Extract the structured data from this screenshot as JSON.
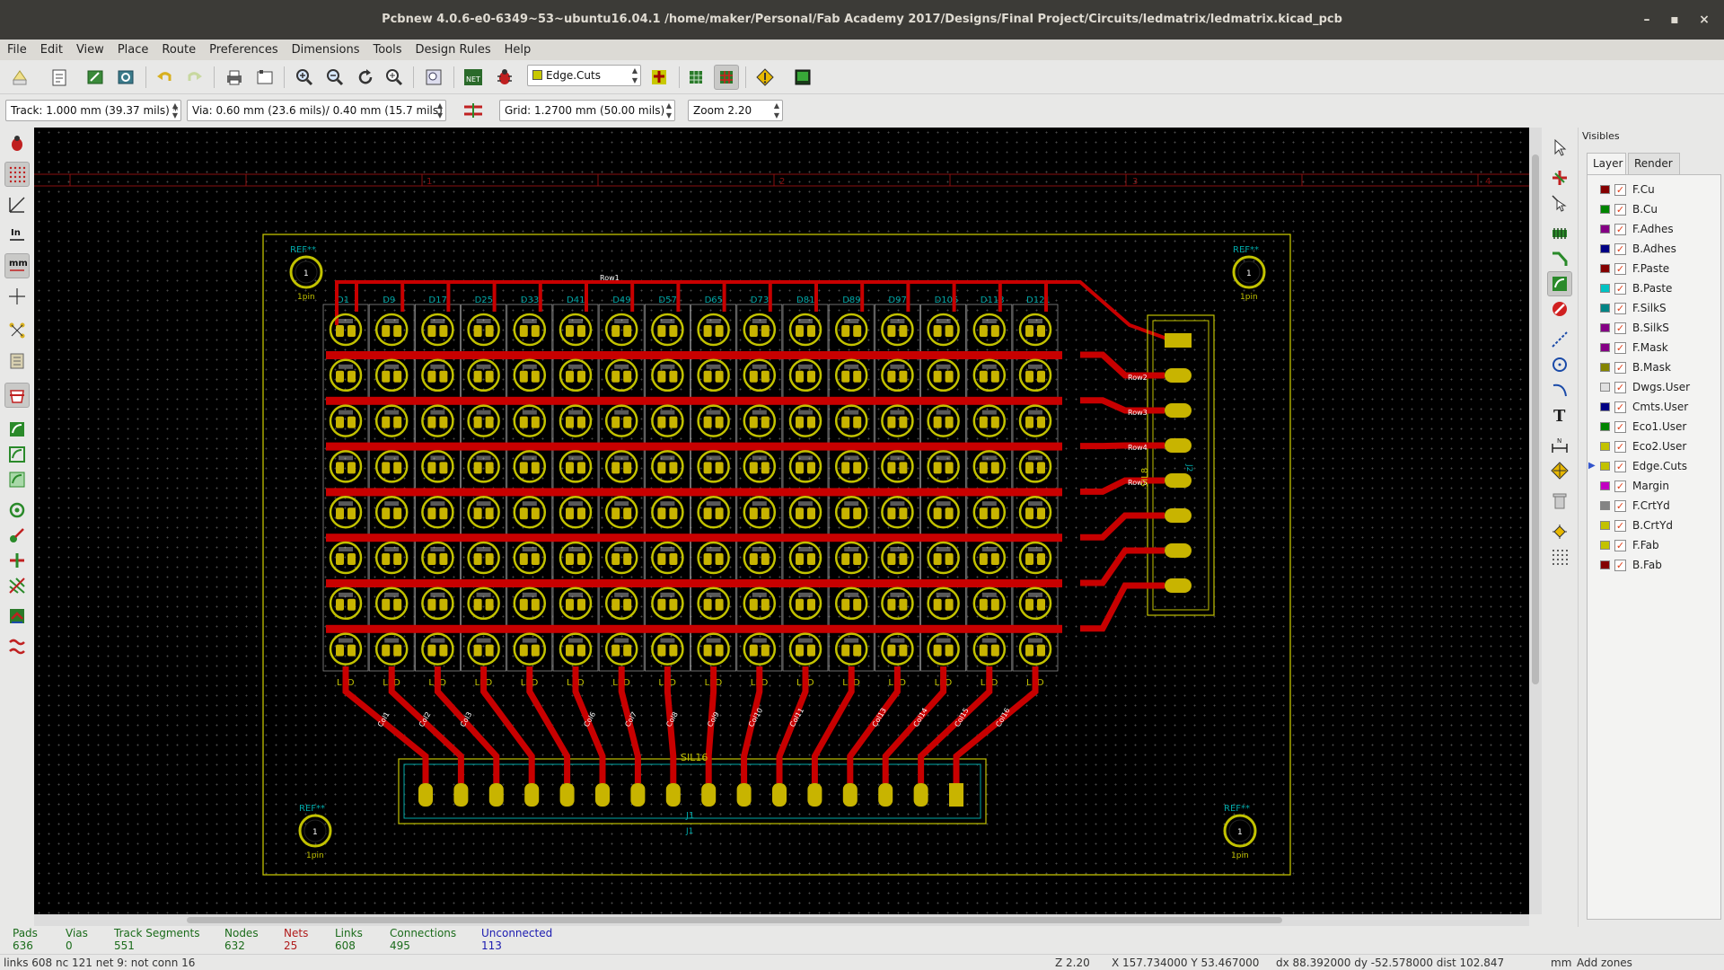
{
  "window": {
    "title": "Pcbnew 4.0.6-e0-6349~53~ubuntu16.04.1 /home/maker/Personal/Fab Academy 2017/Designs/Final Project/Circuits/ledmatrix/ledmatrix.kicad_pcb",
    "min_glyph": "–",
    "max_glyph": "▪",
    "close_glyph": "×"
  },
  "menu": [
    "File",
    "Edit",
    "View",
    "Place",
    "Route",
    "Preferences",
    "Dimensions",
    "Tools",
    "Design Rules",
    "Help"
  ],
  "toolbar": {
    "active_layer": "Edge.Cuts",
    "active_layer_color": "#c8c800"
  },
  "options": {
    "track": "Track: 1.000 mm (39.37 mils) *",
    "via": "Via: 0.60 mm (23.6 mils)/ 0.40 mm (15.7 mils) *",
    "grid": "Grid: 1.2700 mm (50.00 mils)",
    "zoom": "Zoom 2.20"
  },
  "visibles": {
    "title": "Visibles",
    "tabs": [
      "Layer",
      "Render"
    ],
    "active_tab": "Layer",
    "selected_layer": "Edge.Cuts",
    "layers": [
      {
        "name": "F.Cu",
        "color": "#840000",
        "checked": true
      },
      {
        "name": "B.Cu",
        "color": "#008400",
        "checked": true
      },
      {
        "name": "F.Adhes",
        "color": "#840084",
        "checked": true
      },
      {
        "name": "B.Adhes",
        "color": "#000084",
        "checked": true
      },
      {
        "name": "F.Paste",
        "color": "#840000",
        "checked": true
      },
      {
        "name": "B.Paste",
        "color": "#00c2c2",
        "checked": true
      },
      {
        "name": "F.SilkS",
        "color": "#008484",
        "checked": true
      },
      {
        "name": "B.SilkS",
        "color": "#840084",
        "checked": true
      },
      {
        "name": "F.Mask",
        "color": "#840084",
        "checked": true
      },
      {
        "name": "B.Mask",
        "color": "#848400",
        "checked": true
      },
      {
        "name": "Dwgs.User",
        "color": "#e0e0e0",
        "checked": true
      },
      {
        "name": "Cmts.User",
        "color": "#000084",
        "checked": true
      },
      {
        "name": "Eco1.User",
        "color": "#008400",
        "checked": true
      },
      {
        "name": "Eco2.User",
        "color": "#c2c200",
        "checked": true
      },
      {
        "name": "Edge.Cuts",
        "color": "#c2c200",
        "checked": true
      },
      {
        "name": "Margin",
        "color": "#c200c2",
        "checked": true
      },
      {
        "name": "F.CrtYd",
        "color": "#848484",
        "checked": true
      },
      {
        "name": "B.CrtYd",
        "color": "#c2c200",
        "checked": true
      },
      {
        "name": "F.Fab",
        "color": "#c2c200",
        "checked": true
      },
      {
        "name": "B.Fab",
        "color": "#840000",
        "checked": true
      }
    ]
  },
  "stats": [
    {
      "label": "Pads",
      "value": "636",
      "color": "#1a6b1a"
    },
    {
      "label": "Vias",
      "value": "0",
      "color": "#1a6b1a"
    },
    {
      "label": "Track Segments",
      "value": "551",
      "color": "#1a6b1a"
    },
    {
      "label": "Nodes",
      "value": "632",
      "color": "#1a6b1a"
    },
    {
      "label": "Nets",
      "value": "25",
      "color": "#b01a1a"
    },
    {
      "label": "Links",
      "value": "608",
      "color": "#1a6b1a"
    },
    {
      "label": "Connections",
      "value": "495",
      "color": "#1a6b1a"
    },
    {
      "label": "Unconnected",
      "value": "113",
      "color": "#1a1ab0"
    }
  ],
  "statusbar": {
    "message": "links 608 nc 121  net 9: not conn 16",
    "zoom": "Z 2.20",
    "xy": "X 157.734000  Y 53.467000",
    "delta": "dx 88.392000  dy -52.578000  dist 102.847",
    "units": "mm",
    "mode": "Add zones"
  },
  "pcb": {
    "silk_color": "#c2c200",
    "copper_color": "#c80000",
    "pad_color": "#c8b400",
    "text_color": "#00a8a8",
    "top_leds": [
      "D1",
      "D9",
      "D17",
      "D25",
      "D33",
      "D41",
      "D49",
      "D57",
      "D65",
      "D73",
      "D81",
      "D89",
      "D97",
      "D105",
      "D113",
      "D121"
    ],
    "led_label": "LED",
    "row_net": "Row1",
    "row_labels": [
      "Row2",
      "Row3",
      "Row4",
      "Row5"
    ],
    "col_labels": [
      "Col1",
      "Col2",
      "Col3",
      "Col6",
      "Col7",
      "Col8",
      "Col9",
      "Col10",
      "Col11",
      "Col13",
      "Col14",
      "Col15",
      "Col16"
    ],
    "ref": "REF**",
    "pin_label": "1pin",
    "pin_num": "1",
    "j1_ref": "J1",
    "j2_ref": "J2",
    "sil16": "SIL16",
    "sil8": "SIL8",
    "ruler_nums": [
      "1",
      "2",
      "3",
      "4",
      "5",
      "6"
    ]
  }
}
